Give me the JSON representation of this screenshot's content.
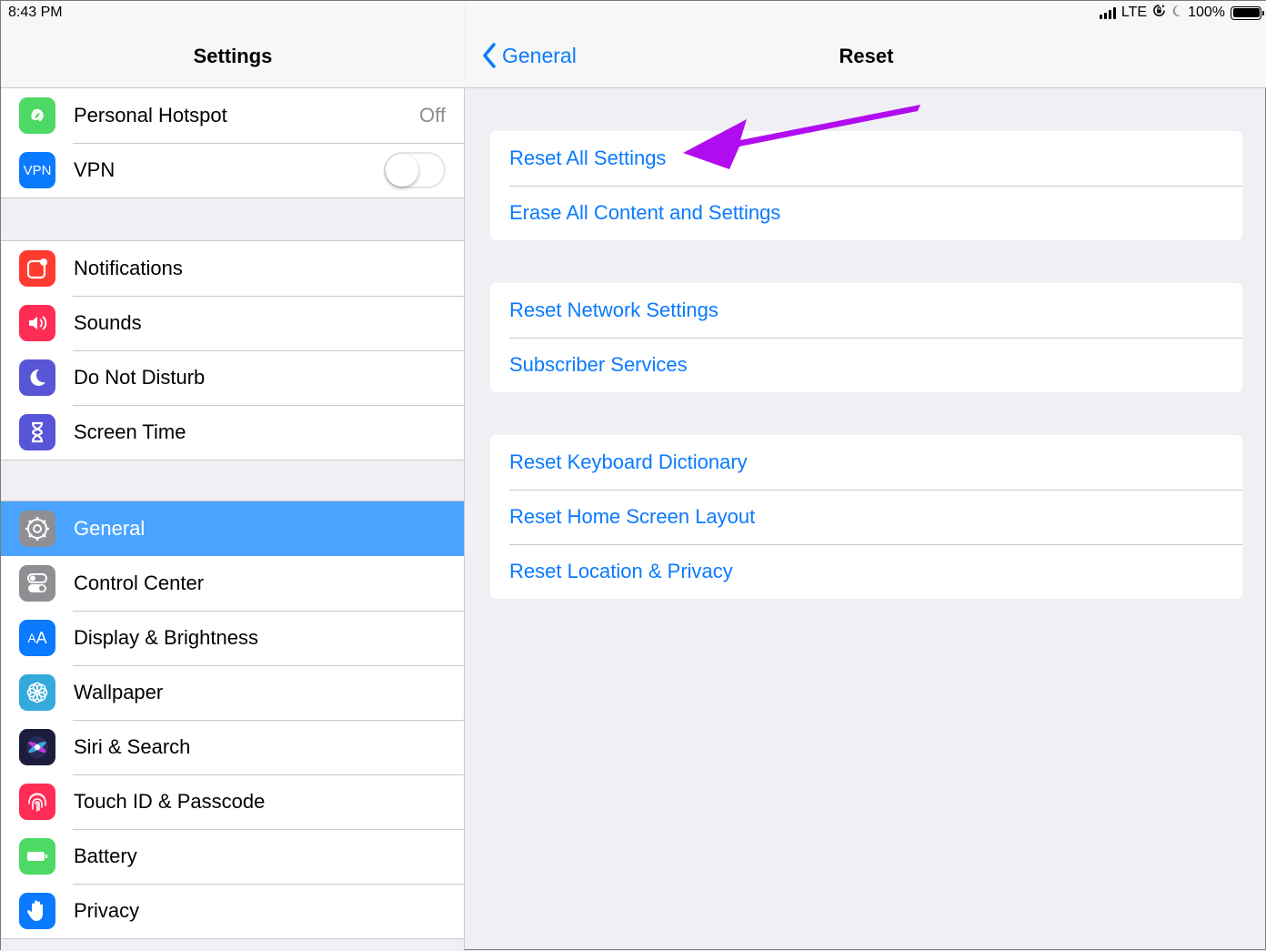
{
  "status": {
    "time": "8:43 PM",
    "network": "LTE",
    "battery": "100%"
  },
  "sidebar": {
    "title": "Settings",
    "groups": [
      {
        "items": [
          {
            "label": "Personal Hotspot",
            "icon": "hotspot-icon",
            "color": "#4cd964",
            "detail": "Off"
          },
          {
            "label": "VPN",
            "icon": "vpn-icon",
            "color": "#0a7aff",
            "toggle": false
          }
        ]
      },
      {
        "items": [
          {
            "label": "Notifications",
            "icon": "notifications-icon",
            "color": "#ff3b30"
          },
          {
            "label": "Sounds",
            "icon": "speaker-icon",
            "color": "#ff2d55"
          },
          {
            "label": "Do Not Disturb",
            "icon": "moon-icon",
            "color": "#5856d6"
          },
          {
            "label": "Screen Time",
            "icon": "hourglass-icon",
            "color": "#5856d6"
          }
        ]
      },
      {
        "items": [
          {
            "label": "General",
            "icon": "gear-icon",
            "color": "#8e8e93",
            "selected": true
          },
          {
            "label": "Control Center",
            "icon": "switches-icon",
            "color": "#8e8e93"
          },
          {
            "label": "Display & Brightness",
            "icon": "text-size-icon",
            "color": "#0a7aff"
          },
          {
            "label": "Wallpaper",
            "icon": "flower-icon",
            "color": "#34aadc"
          },
          {
            "label": "Siri & Search",
            "icon": "siri-icon",
            "color": "#1c1c3c"
          },
          {
            "label": "Touch ID & Passcode",
            "icon": "fingerprint-icon",
            "color": "#ff2d55"
          },
          {
            "label": "Battery",
            "icon": "battery-icon",
            "color": "#4cd964"
          },
          {
            "label": "Privacy",
            "icon": "hand-icon",
            "color": "#0a7aff"
          }
        ]
      }
    ]
  },
  "detail": {
    "back_label": "General",
    "title": "Reset",
    "groups": [
      {
        "items": [
          "Reset All Settings",
          "Erase All Content and Settings"
        ]
      },
      {
        "items": [
          "Reset Network Settings",
          "Subscriber Services"
        ]
      },
      {
        "items": [
          "Reset Keyboard Dictionary",
          "Reset Home Screen Layout",
          "Reset Location & Privacy"
        ]
      }
    ],
    "annotation_color": "#b10cf0"
  }
}
